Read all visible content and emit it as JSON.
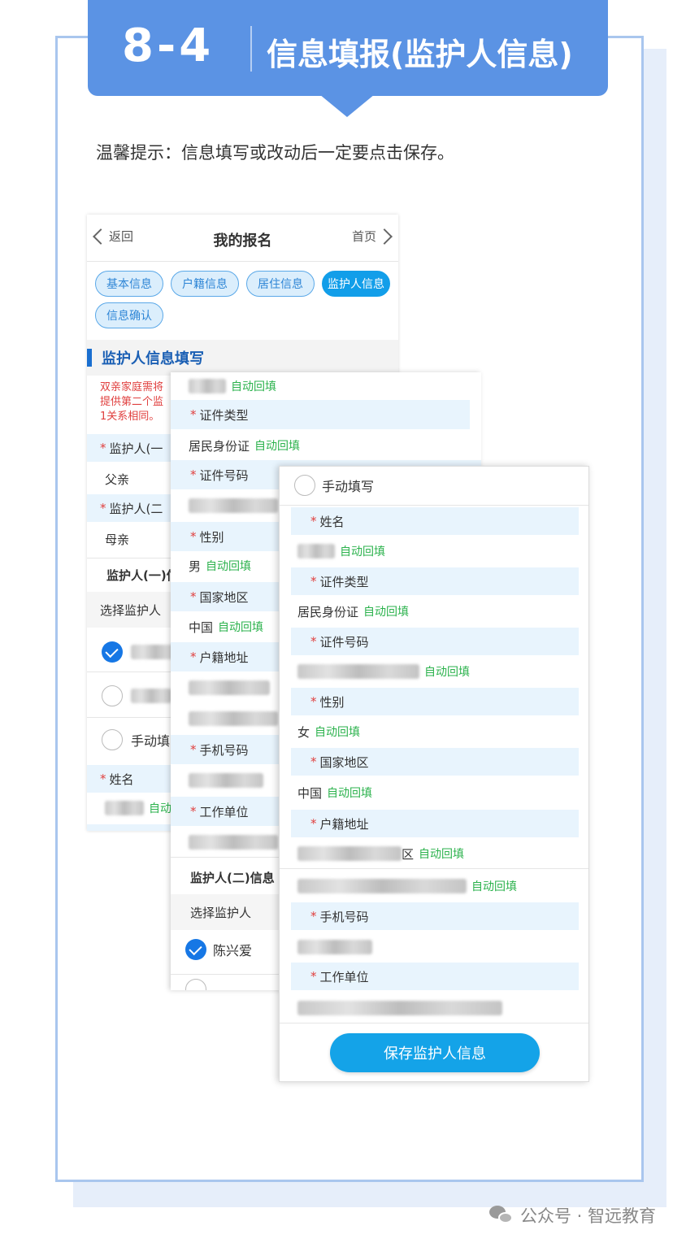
{
  "header": {
    "number": "8-4",
    "title": "信息填报(监护人信息)"
  },
  "tip": "温馨提示：信息填写或改动后一定要点击保存。",
  "footer": "公众号 · 智远教育",
  "app": {
    "back": "返回",
    "title": "我的报名",
    "home": "首页",
    "tabs": [
      "基本信息",
      "户籍信息",
      "居住信息",
      "监护人信息",
      "信息确认"
    ],
    "section_title": "监护人信息填写",
    "warning": [
      "双亲家庭需将",
      "提供第二个监",
      "1关系相同。"
    ]
  },
  "labels": {
    "guardian1": "监护人(一",
    "guardian2": "监护人(二",
    "guardian1_info": "监护人(一)信",
    "guardian2_info": "监护人(二)信息",
    "select": "选择监护人",
    "manual_short": "手动填",
    "manual": "手动填写",
    "name": "姓名",
    "id_type": "证件类型",
    "id_no": "证件号码",
    "gender": "性别",
    "country": "国家地区",
    "hukou": "户籍地址",
    "phone": "手机号码",
    "work": "工作单位"
  },
  "values": {
    "father": "父亲",
    "mother": "母亲",
    "id_card": "居民身份证",
    "male": "男",
    "female": "女",
    "china": "中国",
    "selected_guardian": "陈兴爱",
    "district_suffix": "区",
    "auto": "自动回填",
    "auto_short": "自动"
  },
  "save_button": "保存监护人信息",
  "colors": {
    "accent": "#5b93e4",
    "primary_button": "#14a3e8",
    "auto_fill": "#2bb24c",
    "required": "#e0403f"
  }
}
